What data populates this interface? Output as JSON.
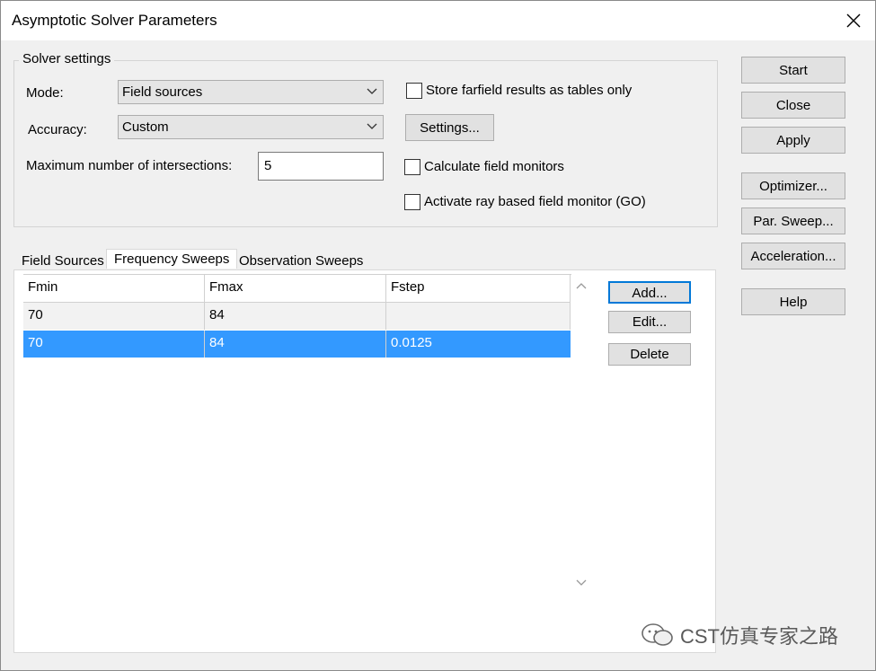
{
  "window": {
    "title": "Asymptotic Solver Parameters"
  },
  "solver_settings": {
    "group_label": "Solver settings",
    "mode_label": "Mode:",
    "mode_value": "Field sources",
    "accuracy_label": "Accuracy:",
    "accuracy_value": "Custom",
    "max_intersections_label": "Maximum number of intersections:",
    "max_intersections_value": "5",
    "store_farfield_label": "Store farfield results as tables only",
    "settings_button": "Settings...",
    "calc_field_monitors_label": "Calculate field monitors",
    "ray_field_monitor_label": "Activate ray based field monitor (GO)"
  },
  "tabs": [
    {
      "label": "Field Sources"
    },
    {
      "label": "Frequency Sweeps"
    },
    {
      "label": "Observation Sweeps"
    }
  ],
  "sweeps_table": {
    "columns": [
      "Fmin",
      "Fmax",
      "Fstep"
    ],
    "rows": [
      [
        "70",
        "84",
        ""
      ],
      [
        "70",
        "84",
        "0.0125"
      ]
    ]
  },
  "table_buttons": {
    "add": "Add...",
    "edit": "Edit...",
    "delete": "Delete"
  },
  "side_buttons": {
    "start": "Start",
    "close": "Close",
    "apply": "Apply",
    "optimizer": "Optimizer...",
    "par_sweep": "Par. Sweep...",
    "acceleration": "Acceleration...",
    "help": "Help"
  },
  "watermark": {
    "text": "CST仿真专家之路"
  }
}
